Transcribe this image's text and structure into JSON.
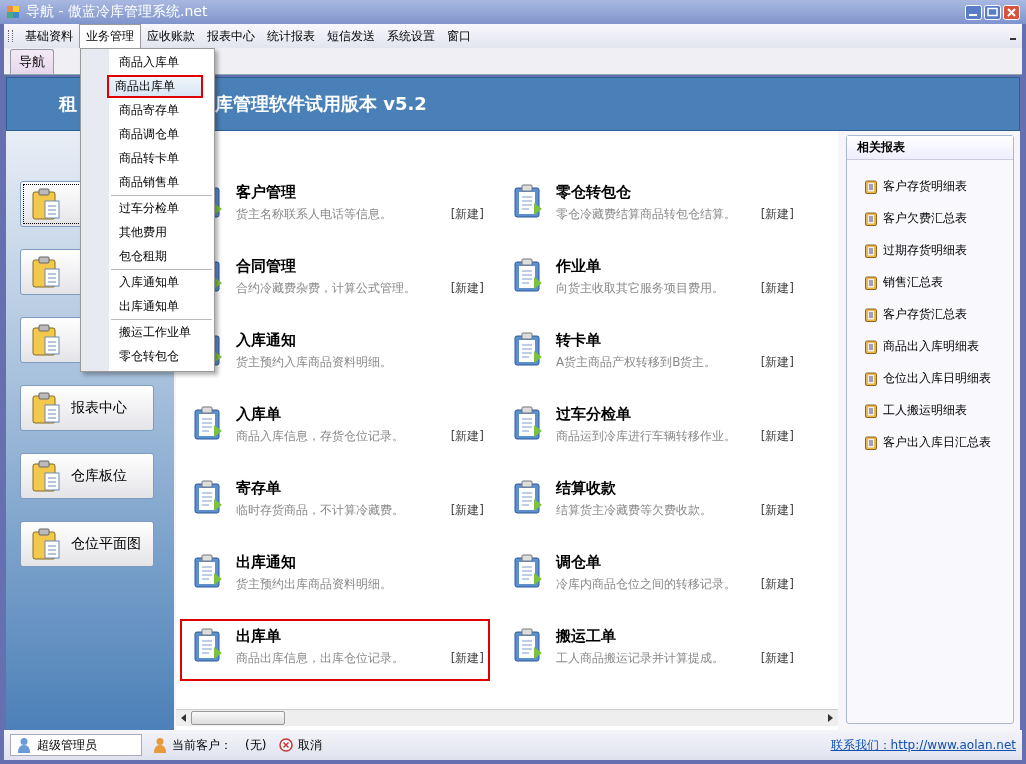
{
  "window": {
    "title": "导航 - 傲蓝冷库管理系统.net"
  },
  "menu_bar": [
    {
      "label": "基础资料",
      "selected": false
    },
    {
      "label": "业务管理",
      "selected": true
    },
    {
      "label": "应收账款",
      "selected": false
    },
    {
      "label": "报表中心",
      "selected": false
    },
    {
      "label": "统计报表",
      "selected": false
    },
    {
      "label": "短信发送",
      "selected": false
    },
    {
      "label": "系统设置",
      "selected": false
    },
    {
      "label": "窗口",
      "selected": false
    }
  ],
  "tabs": [
    {
      "label": "导航",
      "selected": true
    }
  ],
  "banner": {
    "left": "租",
    "right": "库管理软件试用版本 v5.2"
  },
  "dropdown": {
    "groups": [
      [
        {
          "label": "商品入库单",
          "selected": false
        },
        {
          "label": "商品出库单",
          "selected": true
        },
        {
          "label": "商品寄存单",
          "selected": false
        },
        {
          "label": "商品调仓单",
          "selected": false
        },
        {
          "label": "商品转卡单",
          "selected": false
        },
        {
          "label": "商品销售单",
          "selected": false
        }
      ],
      [
        {
          "label": "过车分检单",
          "selected": false
        },
        {
          "label": "其他费用",
          "selected": false
        },
        {
          "label": "包仓租期",
          "selected": false
        }
      ],
      [
        {
          "label": "入库通知单",
          "selected": false
        },
        {
          "label": "出库通知单",
          "selected": false
        }
      ],
      [
        {
          "label": "搬运工作业单",
          "selected": false
        },
        {
          "label": "零仓转包仓",
          "selected": false
        }
      ]
    ]
  },
  "side_buttons": [
    {
      "focused": true
    },
    {
      "focused": false
    },
    {
      "focused": false
    },
    {
      "label": "报表中心",
      "focused": false
    },
    {
      "label": "仓库板位",
      "focused": false
    },
    {
      "label": "仓位平面图",
      "focused": false
    }
  ],
  "modules": [
    {
      "title": "客户管理",
      "desc": "货主名称联系人电话等信息。",
      "action": "[新建]",
      "highlighted": false
    },
    {
      "title": "零仓转包仓",
      "desc": "零仓冷藏费结算商品转包仓结算。",
      "action": "[新建]",
      "highlighted": false
    },
    {
      "title": "合同管理",
      "desc": "合约冷藏费杂费，计算公式管理。",
      "action": "[新建]",
      "highlighted": false
    },
    {
      "title": "作业单",
      "desc": "向货主收取其它服务项目费用。",
      "action": "[新建]",
      "highlighted": false
    },
    {
      "title": "入库通知",
      "desc": "货主预约入库商品资料明细。",
      "highlighted": false
    },
    {
      "title": "转卡单",
      "desc": "A货主商品产权转移到B货主。",
      "action": "[新建]",
      "highlighted": false
    },
    {
      "title": "入库单",
      "desc": "商品入库信息，存货仓位记录。",
      "action": "[新建]",
      "highlighted": false
    },
    {
      "title": "过车分检单",
      "desc": "商品运到冷库进行车辆转移作业。",
      "action": "[新建]",
      "highlighted": false
    },
    {
      "title": "寄存单",
      "desc": "临时存货商品，不计算冷藏费。",
      "action": "[新建]",
      "highlighted": false
    },
    {
      "title": "结算收款",
      "desc": "结算货主冷藏费等欠费收款。",
      "action": "[新建]",
      "highlighted": false
    },
    {
      "title": "出库通知",
      "desc": "货主预约出库商品资料明细。",
      "highlighted": false
    },
    {
      "title": "调仓单",
      "desc": "冷库内商品仓位之间的转移记录。",
      "action": "[新建]",
      "highlighted": false
    },
    {
      "title": "出库单",
      "desc": "商品出库信息，出库仓位记录。",
      "action": "[新建]",
      "highlighted": true
    },
    {
      "title": "搬运工单",
      "desc": "工人商品搬运记录并计算提成。",
      "action": "[新建]",
      "highlighted": false
    }
  ],
  "reports": {
    "title": "相关报表",
    "items": [
      "客户存货明细表",
      "客户欠费汇总表",
      "过期存货明细表",
      "销售汇总表",
      "客户存货汇总表",
      "商品出入库明细表",
      "仓位出入库日明细表",
      "工人搬运明细表",
      "客户出入库日汇总表"
    ]
  },
  "status_bar": {
    "user": "超级管理员",
    "customer_label": "当前客户：",
    "customer": "(无)",
    "cancel": "取消",
    "contact": "联系我们：http://www.aolan.net"
  }
}
